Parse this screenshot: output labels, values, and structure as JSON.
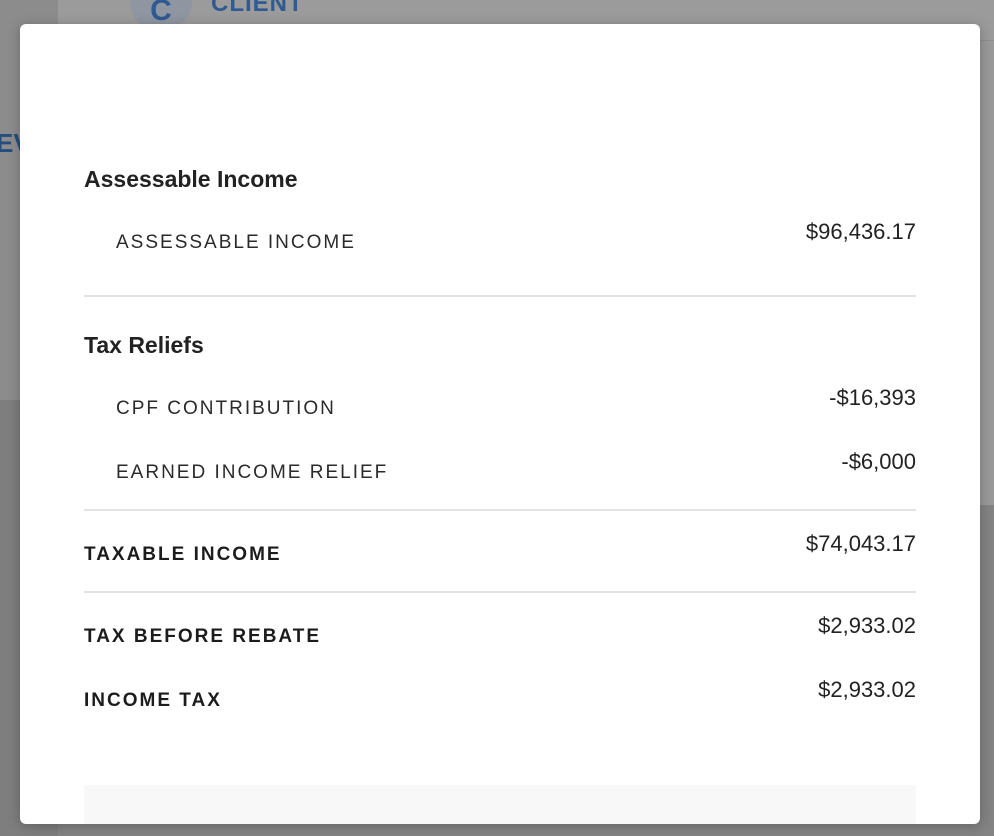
{
  "background": {
    "avatar_letter": "C",
    "client_label": "CLIENT",
    "left_fragment": "EV"
  },
  "modal": {
    "assessable_section": {
      "title": "Assessable Income",
      "rows": [
        {
          "label": "ASSESSABLE INCOME",
          "value": "$96,436.17"
        }
      ]
    },
    "reliefs_section": {
      "title": "Tax Reliefs",
      "rows": [
        {
          "label": "CPF CONTRIBUTION",
          "value": "-$16,393"
        },
        {
          "label": "EARNED INCOME RELIEF",
          "value": "-$6,000"
        }
      ]
    },
    "taxable_income": {
      "label": "TAXABLE INCOME",
      "value": "$74,043.17"
    },
    "tax_before_rebate": {
      "label": "TAX BEFORE REBATE",
      "value": "$2,933.02"
    },
    "income_tax": {
      "label": "INCOME TAX",
      "value": "$2,933.02"
    }
  }
}
